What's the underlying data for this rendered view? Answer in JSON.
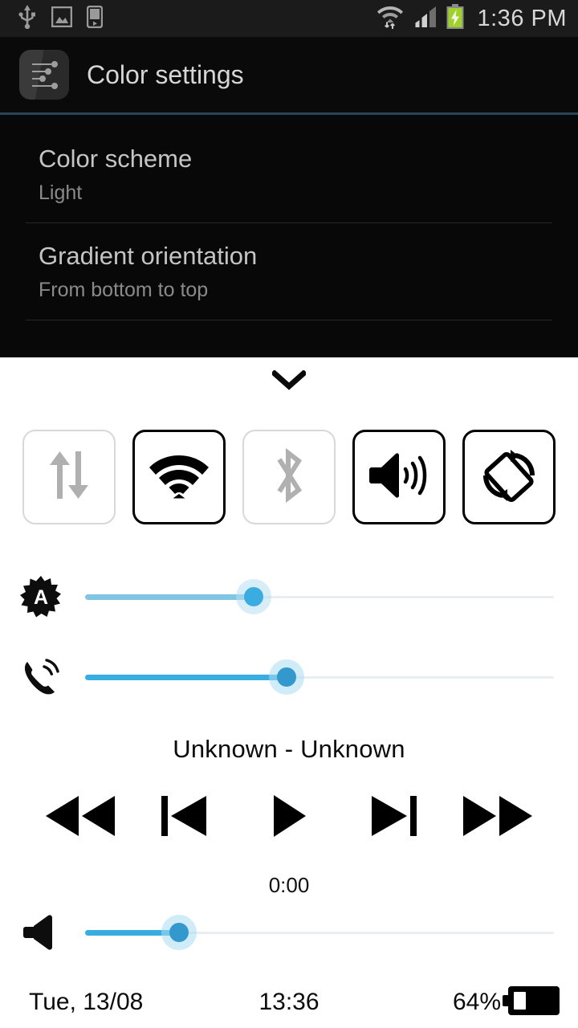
{
  "statusbar": {
    "left_icons": [
      "usb-icon",
      "screenshot-image-icon",
      "media-player-icon"
    ],
    "right_icons": [
      "wifi-transfer-icon",
      "cellular-signal-icon",
      "battery-charging-icon"
    ],
    "clock": "1:36 PM",
    "signal_bars_total": 4,
    "signal_bars_filled": 2,
    "background": "#1b1b1b",
    "battery_charging_color": "#99cc00"
  },
  "titlebar": {
    "icon": "color-settings-icon",
    "title": "Color settings",
    "accent_color": "#2d4354"
  },
  "settings": {
    "items": [
      {
        "title": "Color scheme",
        "value": "Light"
      },
      {
        "title": "Gradient orientation",
        "value": "From bottom to top"
      }
    ]
  },
  "quickpanel": {
    "handle_icon": "chevron-down-icon",
    "toggles": [
      {
        "name": "mobile-data",
        "icon": "data-transfer-icon",
        "state": "off"
      },
      {
        "name": "wifi",
        "icon": "wifi-icon",
        "state": "on"
      },
      {
        "name": "bluetooth",
        "icon": "bluetooth-icon",
        "state": "off"
      },
      {
        "name": "sound",
        "icon": "speaker-waves-icon",
        "state": "on"
      },
      {
        "name": "auto-rotate",
        "icon": "screen-rotate-icon",
        "state": "on"
      }
    ],
    "sliders": [
      {
        "name": "brightness",
        "icon": "auto-brightness-icon",
        "percent": 36,
        "fill_color": "#7fc5e4",
        "thumb_color": "#3bace0",
        "halo_color": "#b6e0f2"
      },
      {
        "name": "ringer-volume",
        "icon": "phone-ring-icon",
        "percent": 43,
        "fill_color": "#38ade0",
        "thumb_color": "#3399cc",
        "halo_color": "#a9dcf2"
      }
    ]
  },
  "media": {
    "track_title": "Unknown - Unknown",
    "elapsed": "0:00",
    "controls": [
      {
        "name": "rewind",
        "icon": "rewind-icon"
      },
      {
        "name": "previous",
        "icon": "previous-track-icon"
      },
      {
        "name": "play",
        "icon": "play-icon"
      },
      {
        "name": "next",
        "icon": "next-track-icon"
      },
      {
        "name": "fast-forward",
        "icon": "fast-forward-icon"
      }
    ],
    "volume_slider": {
      "name": "media-volume",
      "icon": "speaker-icon",
      "percent": 20,
      "fill_color": "#38ade0",
      "thumb_color": "#3399cc",
      "halo_color": "#a9dcf2"
    }
  },
  "bottombar": {
    "date": "Tue, 13/08",
    "time": "13:36",
    "battery_percent": "64%",
    "battery_icon": "battery-icon"
  }
}
